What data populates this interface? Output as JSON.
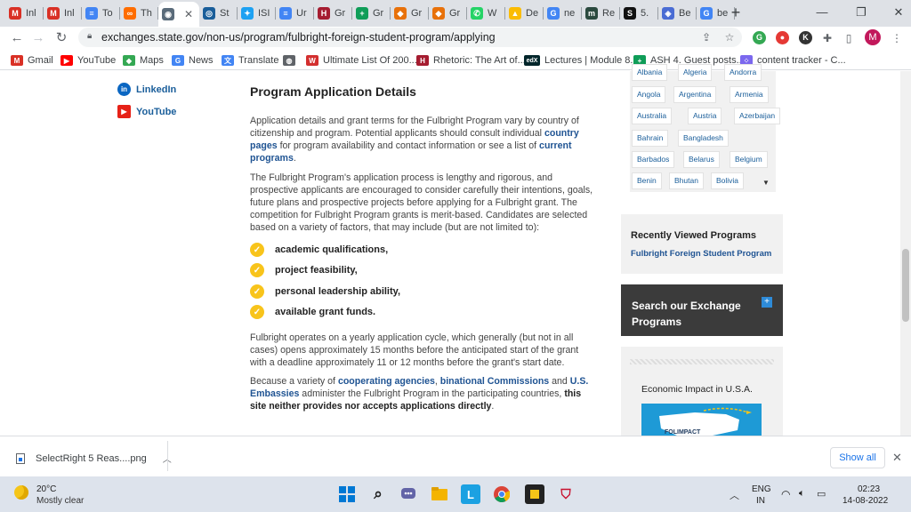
{
  "browser": {
    "tabs": [
      {
        "title": "Inl",
        "icon": "gmail-icon",
        "color": "#d93025",
        "glyph": "M"
      },
      {
        "title": "Inl",
        "icon": "gmail-icon",
        "color": "#d93025",
        "glyph": "M"
      },
      {
        "title": "To",
        "icon": "docs-icon",
        "color": "#4285f4",
        "glyph": "≡"
      },
      {
        "title": "Th",
        "icon": "link-icon",
        "color": "#ff6d00",
        "glyph": "∞"
      },
      {
        "title": "",
        "icon": "state-seal-icon",
        "color": "#5a6b7a",
        "glyph": "◉",
        "active": true
      },
      {
        "title": "St",
        "icon": "exchange-icon",
        "color": "#1a5e9a",
        "glyph": "◎"
      },
      {
        "title": "ISI",
        "icon": "twitter-icon",
        "color": "#1da1f2",
        "glyph": "✦"
      },
      {
        "title": "Ur",
        "icon": "docs-icon",
        "color": "#4285f4",
        "glyph": "≡"
      },
      {
        "title": "Gr",
        "icon": "harvard-icon",
        "color": "#a51c30",
        "glyph": "H"
      },
      {
        "title": "Gr",
        "icon": "sheets-icon",
        "color": "#0f9d58",
        "glyph": "+"
      },
      {
        "title": "Gr",
        "icon": "code-icon",
        "color": "#e8710a",
        "glyph": "◆"
      },
      {
        "title": "Gr",
        "icon": "code-icon",
        "color": "#e8710a",
        "glyph": "◆"
      },
      {
        "title": "W",
        "icon": "whatsapp-icon",
        "color": "#25d366",
        "glyph": "✆"
      },
      {
        "title": "De",
        "icon": "drive-icon",
        "color": "#fbbc04",
        "glyph": "▲"
      },
      {
        "title": "ne",
        "icon": "google-icon",
        "color": "#4285f4",
        "glyph": "G"
      },
      {
        "title": "Re",
        "icon": "site-icon",
        "color": "#2b4a3f",
        "glyph": "m"
      },
      {
        "title": "5.",
        "icon": "site-icon",
        "color": "#111111",
        "glyph": "S"
      },
      {
        "title": "Be",
        "icon": "shield-icon",
        "color": "#4a6cd4",
        "glyph": "◈"
      },
      {
        "title": "be",
        "icon": "google-icon",
        "color": "#4285f4",
        "glyph": "G"
      }
    ],
    "url": "exchanges.state.gov/non-us/program/fulbright-foreign-student-program/applying",
    "profile_initial": "M",
    "bookmarks": [
      {
        "label": "Gmail",
        "icon": "gmail-icon",
        "color": "#d93025",
        "glyph": "M"
      },
      {
        "label": "YouTube",
        "icon": "youtube-icon",
        "color": "#ff0000",
        "glyph": "▶"
      },
      {
        "label": "Maps",
        "icon": "maps-icon",
        "color": "#34a853",
        "glyph": "◆"
      },
      {
        "label": "News",
        "icon": "news-icon",
        "color": "#4285f4",
        "glyph": "G"
      },
      {
        "label": "Translate",
        "icon": "translate-icon",
        "color": "#4285f4",
        "glyph": "文"
      },
      {
        "label": "",
        "icon": "globe-icon",
        "color": "#5f6368",
        "glyph": "◍"
      },
      {
        "label": "Ultimate List Of 200...",
        "icon": "w-icon",
        "color": "#d32f2f",
        "glyph": "W"
      },
      {
        "label": "Rhetoric: The Art of...",
        "icon": "harvard-icon",
        "color": "#a51c30",
        "glyph": "H"
      },
      {
        "label": "Lectures | Module 8...",
        "icon": "edx-icon",
        "color": "#02262b",
        "glyph": "edX"
      },
      {
        "label": "ASH 4. Guest posts...",
        "icon": "sheets-icon",
        "color": "#0f9d58",
        "glyph": "+"
      },
      {
        "label": "content tracker - C...",
        "icon": "clickup-icon",
        "color": "#7b68ee",
        "glyph": "⁘"
      }
    ]
  },
  "sidebar_left": {
    "linkedin": "LinkedIn",
    "youtube": "YouTube"
  },
  "article": {
    "title": "Program Application Details",
    "p1_a": "Application details and grant terms for the Fulbright Program vary by country of citizenship and program.  Potential applicants should consult individual ",
    "p1_link1": "country pages",
    "p1_b": " for program availability and contact information or see a list of ",
    "p1_link2": "current programs",
    "p1_c": ".",
    "p2": "The Fulbright Program's application process is lengthy and rigorous, and prospective applicants are encouraged to consider carefully their intentions, goals, future plans and prospective projects before applying for a Fulbright grant. The competition for Fulbright Program grants is merit-based. Candidates are selected based on a variety of factors, that may include (but are not limited to):",
    "factors": [
      "academic qualifications,",
      "project feasibility,",
      "personal leadership ability,",
      "available grant funds."
    ],
    "p3": "Fulbright operates on a yearly application cycle, which generally (but not in all cases) opens approximately 15 months before the anticipated start of the grant with a deadline approximately 11 or 12 months before the grant's start date.",
    "p4_a": "Because a variety of ",
    "p4_link1": "cooperating agencies",
    "p4_b": ", ",
    "p4_link2": "binational Commissions",
    "p4_c": " and ",
    "p4_link3": "U.S. Embassies",
    "p4_d": " administer the Fulbright Program in the participating countries, ",
    "p4_bold": "this site neither provides nor accepts applications directly",
    "p4_e": "."
  },
  "countries": [
    "Albania",
    "Algeria",
    "Andorra",
    "Angola",
    "Argentina",
    "Armenia",
    "Australia",
    "Austria",
    "Azerbaijan",
    "Bahrain",
    "Bangladesh",
    "Barbados",
    "Belarus",
    "Belgium",
    "Benin",
    "Bhutan",
    "Bolivia"
  ],
  "recent": {
    "title": "Recently Viewed Programs",
    "link": "Fulbright Foreign Student Program"
  },
  "search": {
    "title": "Search our Exchange Programs"
  },
  "economic": {
    "title": "Economic Impact in U.S.A.",
    "image_text": "FOLIMPACT"
  },
  "download": {
    "filename": "SelectRight 5 Reas....png",
    "show_all": "Show all"
  },
  "taskbar": {
    "temp": "20°C",
    "weather": "Mostly clear",
    "lang1": "ENG",
    "lang2": "IN",
    "time": "02:23",
    "date": "14-08-2022"
  }
}
